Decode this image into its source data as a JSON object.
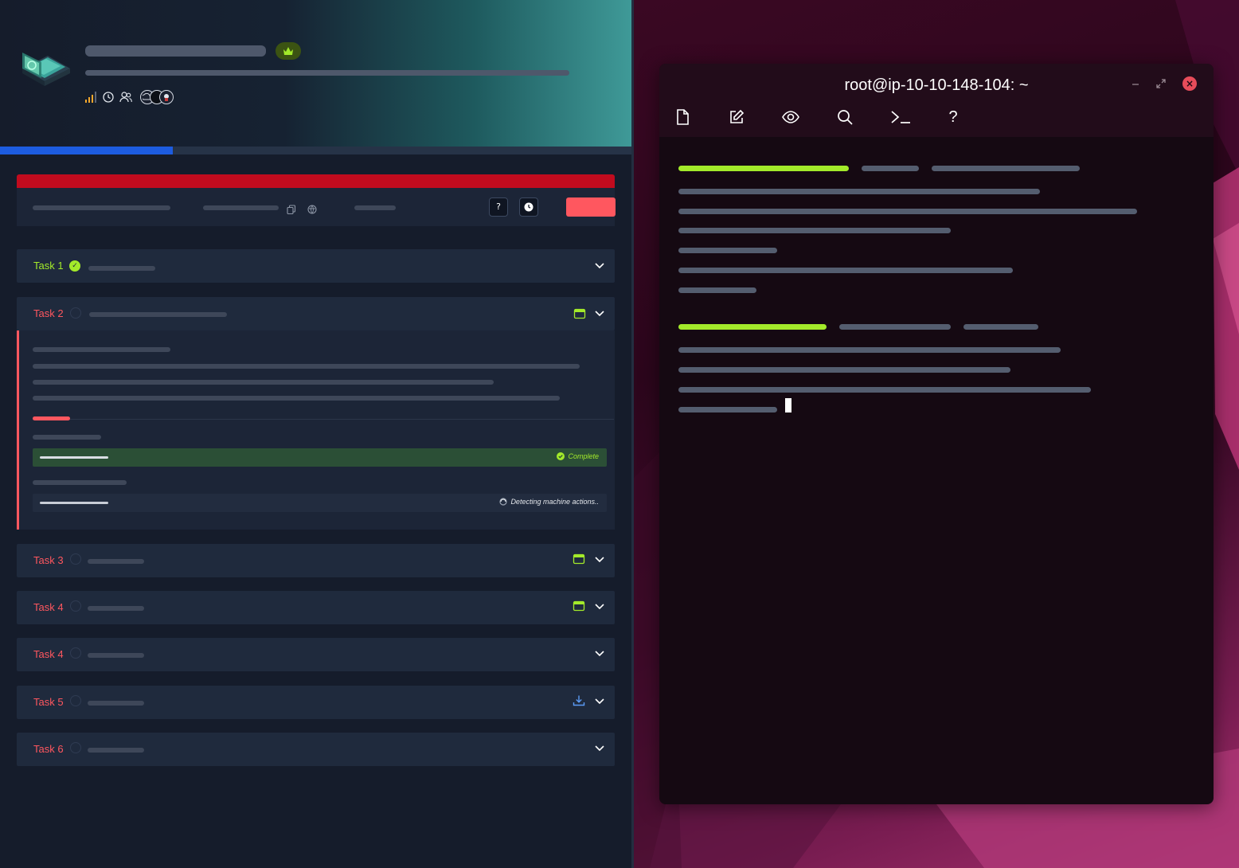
{
  "room": {
    "logo_icon": "laptop-hologram-icon",
    "subscriber_badge_icon": "crown-icon",
    "meta_icons": [
      "difficulty-bars-icon",
      "clock-icon",
      "users-icon"
    ],
    "progress_percent": 27,
    "colors": {
      "accent_green": "#a3ea2a",
      "accent_red": "#ff575f",
      "progress_blue": "#1d5ce0",
      "alert_red": "#c10b1e"
    }
  },
  "machine_card": {
    "help_label": "?",
    "icons": [
      "copy-icon",
      "globe-icon",
      "help-icon",
      "timer-icon"
    ]
  },
  "tasks": [
    {
      "title": "Task 1",
      "completed": true,
      "icon": null
    },
    {
      "title": "Task 2",
      "completed": false,
      "icon": "browser-window-icon",
      "expanded": true
    },
    {
      "title": "Task 3",
      "completed": false,
      "icon": "browser-window-icon"
    },
    {
      "title": "Task 4",
      "completed": false,
      "icon": "browser-window-icon"
    },
    {
      "title": "Task 4",
      "completed": false,
      "icon": null
    },
    {
      "title": "Task 5",
      "completed": false,
      "icon": "download-icon"
    },
    {
      "title": "Task 6",
      "completed": false,
      "icon": null
    }
  ],
  "expanded_task": {
    "answers": [
      {
        "status": "Complete",
        "state": "correct"
      },
      {
        "status": "Detecting machine actions..",
        "state": "pending"
      }
    ]
  },
  "terminal": {
    "title": "root@ip-10-10-148-104: ~",
    "toolbar_icons": [
      "file-icon",
      "edit-icon",
      "eye-icon",
      "search-icon",
      "terminal-prompt-icon",
      "help-icon"
    ],
    "help_label": "?",
    "window_controls": [
      "minimize-icon",
      "restore-icon",
      "close-icon"
    ]
  }
}
